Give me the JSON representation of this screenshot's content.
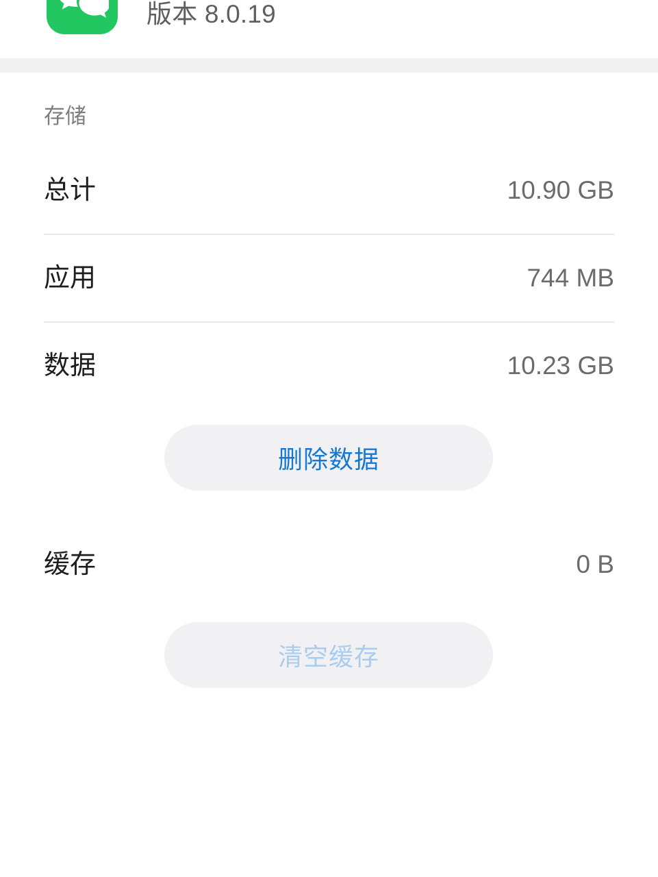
{
  "app": {
    "icon_name": "wechat-app-icon",
    "icon_color": "#23c761",
    "version_text": "版本 8.0.19"
  },
  "storage": {
    "section_title": "存储",
    "rows": [
      {
        "label": "总计",
        "value": "10.90 GB",
        "name": "total"
      },
      {
        "label": "应用",
        "value": "744 MB",
        "name": "app"
      },
      {
        "label": "数据",
        "value": "10.23 GB",
        "name": "data"
      }
    ],
    "cache_row": {
      "label": "缓存",
      "value": "0 B"
    },
    "delete_data_button": {
      "label": "删除数据",
      "color": "#1578d5",
      "background": "#f1f1f3"
    },
    "clear_cache_button": {
      "label": "清空缓存",
      "color": "#a8cdee",
      "background": "#f1f1f3"
    }
  },
  "colors": {
    "accent_blue": "#1578d5",
    "disabled_blue": "#a8cdee",
    "app_green": "#23c761",
    "divider": "#e9e9e9",
    "section_gap": "#f1f1f1",
    "primary_text": "#1d1d1d",
    "secondary_text": "#6b6b6b",
    "muted_text": "#7d7d7d"
  }
}
